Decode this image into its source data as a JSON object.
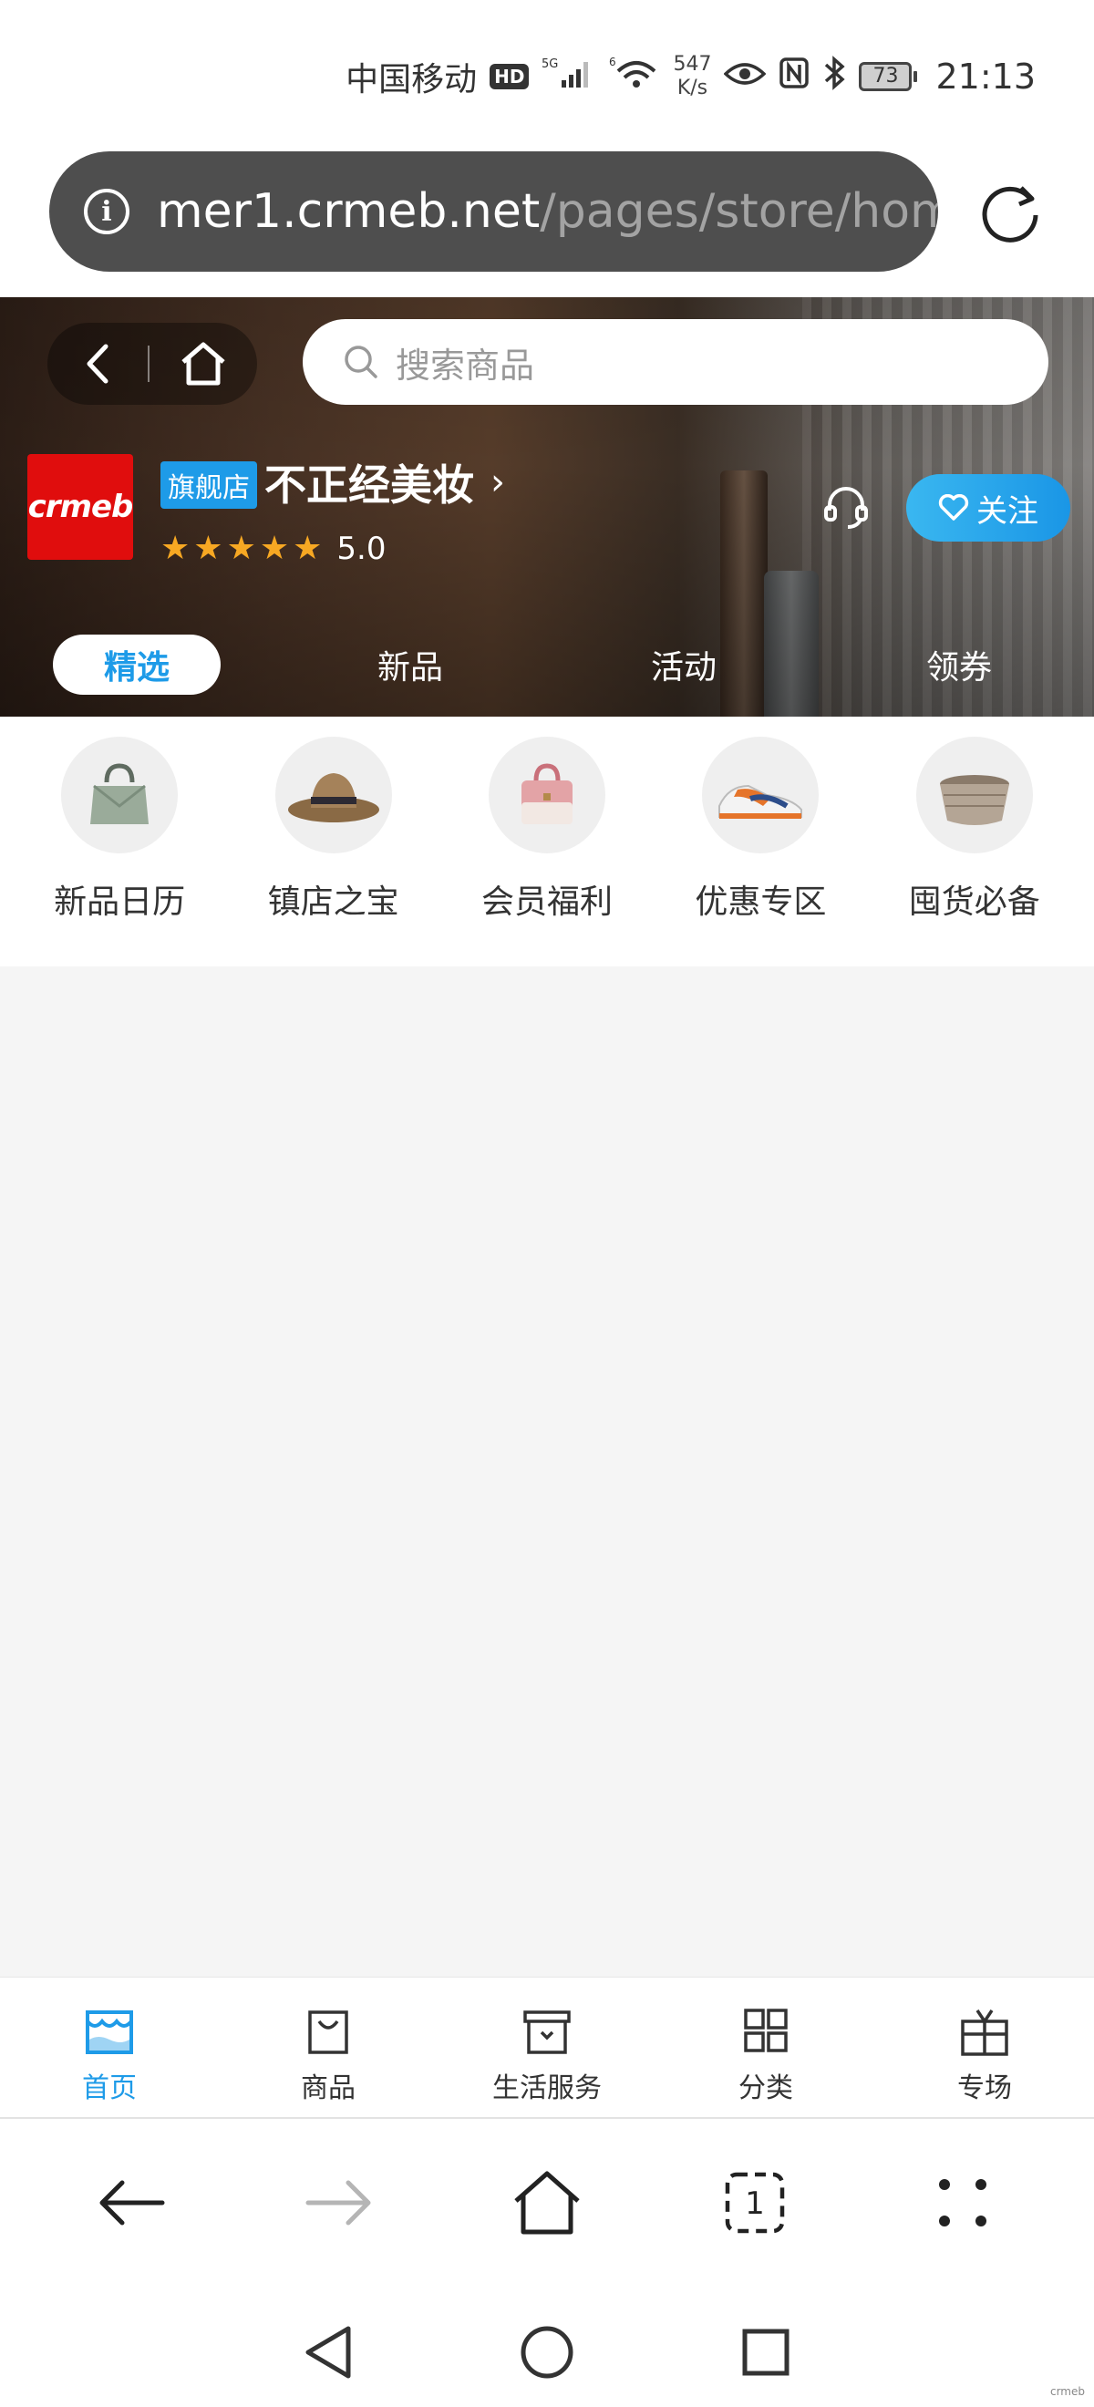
{
  "status_bar": {
    "carrier": "中国移动",
    "hd": "HD",
    "signal_5g": "5G",
    "signal_6": "6",
    "net_speed_value": "547",
    "net_speed_unit": "K/s",
    "battery": "73",
    "time": "21:13"
  },
  "browser": {
    "url_host": "mer1.crmeb.net",
    "url_path": "/pages/store/home",
    "info_symbol": "i"
  },
  "store": {
    "search_placeholder": "搜索商品",
    "logo_text": "crmeb",
    "badge": "旗舰店",
    "name": "不正经美妆",
    "chevron": "›",
    "rating_value": "5.0",
    "rating_stars": 5,
    "follow_label": "关注",
    "tabs": [
      "精选",
      "新品",
      "活动",
      "领券"
    ],
    "active_tab": 0
  },
  "categories": [
    {
      "label": "新品日历",
      "icon": "green-handbag"
    },
    {
      "label": "镇店之宝",
      "icon": "sun-hat"
    },
    {
      "label": "会员福利",
      "icon": "pink-handbag"
    },
    {
      "label": "优惠专区",
      "icon": "sneaker"
    },
    {
      "label": "囤货必备",
      "icon": "basket"
    }
  ],
  "bottom_tabs": [
    {
      "label": "首页",
      "icon": "store-icon",
      "active": true
    },
    {
      "label": "商品",
      "icon": "bag-icon",
      "active": false
    },
    {
      "label": "生活服务",
      "icon": "box-icon",
      "active": false
    },
    {
      "label": "分类",
      "icon": "grid-icon",
      "active": false
    },
    {
      "label": "专场",
      "icon": "gift-icon",
      "active": false
    }
  ],
  "browser_nav": {
    "tab_count": "1"
  },
  "watermark": "crmeb",
  "colors": {
    "accent": "#1e9be8",
    "star": "#f7a823",
    "logo_red": "#e00d0d",
    "url_bar": "#4e4e4e",
    "content_bg": "#f5f5f5"
  }
}
